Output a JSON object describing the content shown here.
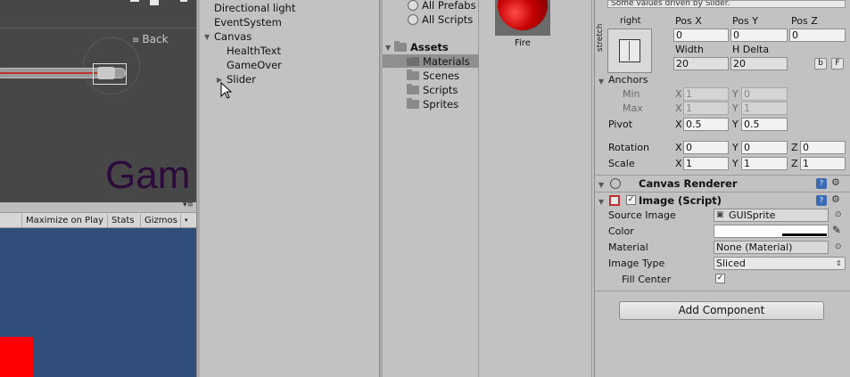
{
  "scene": {
    "back_label": "Back",
    "overlay_text": "Gam"
  },
  "game_view": {
    "toolbar": {
      "maximize_on_play": "Maximize on Play",
      "stats": "Stats",
      "gizmos": "Gizmos"
    }
  },
  "hierarchy": {
    "items": [
      {
        "label": "Directional light"
      },
      {
        "label": "EventSystem"
      },
      {
        "label": "Canvas"
      },
      {
        "label": "HealthText"
      },
      {
        "label": "GameOver"
      },
      {
        "label": "Slider"
      }
    ]
  },
  "project": {
    "favorites": [
      "All Prefabs",
      "All Scripts"
    ],
    "assets_root": "Assets",
    "folders": [
      "Materials",
      "Scenes",
      "Scripts",
      "Sprites"
    ],
    "selected_folder": "Materials",
    "asset_items": [
      {
        "label": "Fire"
      }
    ]
  },
  "inspector": {
    "info_text": "Some values driven by Slider.",
    "rect_transform": {
      "preset_top": "right",
      "preset_side": "stretch",
      "pos_x_label": "Pos X",
      "pos_y_label": "Pos Y",
      "pos_z_label": "Pos Z",
      "pos_x": "0",
      "pos_y": "0",
      "pos_z": "0",
      "width_label": "Width",
      "height_label": "H Delta",
      "width": "20",
      "height": "20",
      "btn_b": "b",
      "btn_r": "F",
      "anchors_label": "Anchors",
      "min_label": "Min",
      "max_label": "Max",
      "min_x": "1",
      "min_y": "0",
      "max_x": "1",
      "max_y": "1",
      "pivot_label": "Pivot",
      "pivot_x": "0.5",
      "pivot_y": "0.5",
      "rotation_label": "Rotation",
      "rot_x": "0",
      "rot_y": "0",
      "rot_z": "0",
      "scale_label": "Scale",
      "scale_x": "1",
      "scale_y": "1",
      "scale_z": "1",
      "axis_x": "X",
      "axis_y": "Y",
      "axis_z": "Z"
    },
    "canvas_renderer": {
      "title": "Canvas Renderer"
    },
    "image": {
      "title": "Image (Script)",
      "source_image_label": "Source Image",
      "source_image_value": "GUISprite",
      "color_label": "Color",
      "color_value": "#ffffff",
      "material_label": "Material",
      "material_value": "None (Material)",
      "image_type_label": "Image Type",
      "image_type_value": "Sliced",
      "fill_center_label": "Fill Center",
      "fill_center_checked": true
    },
    "add_component": "Add Component"
  }
}
